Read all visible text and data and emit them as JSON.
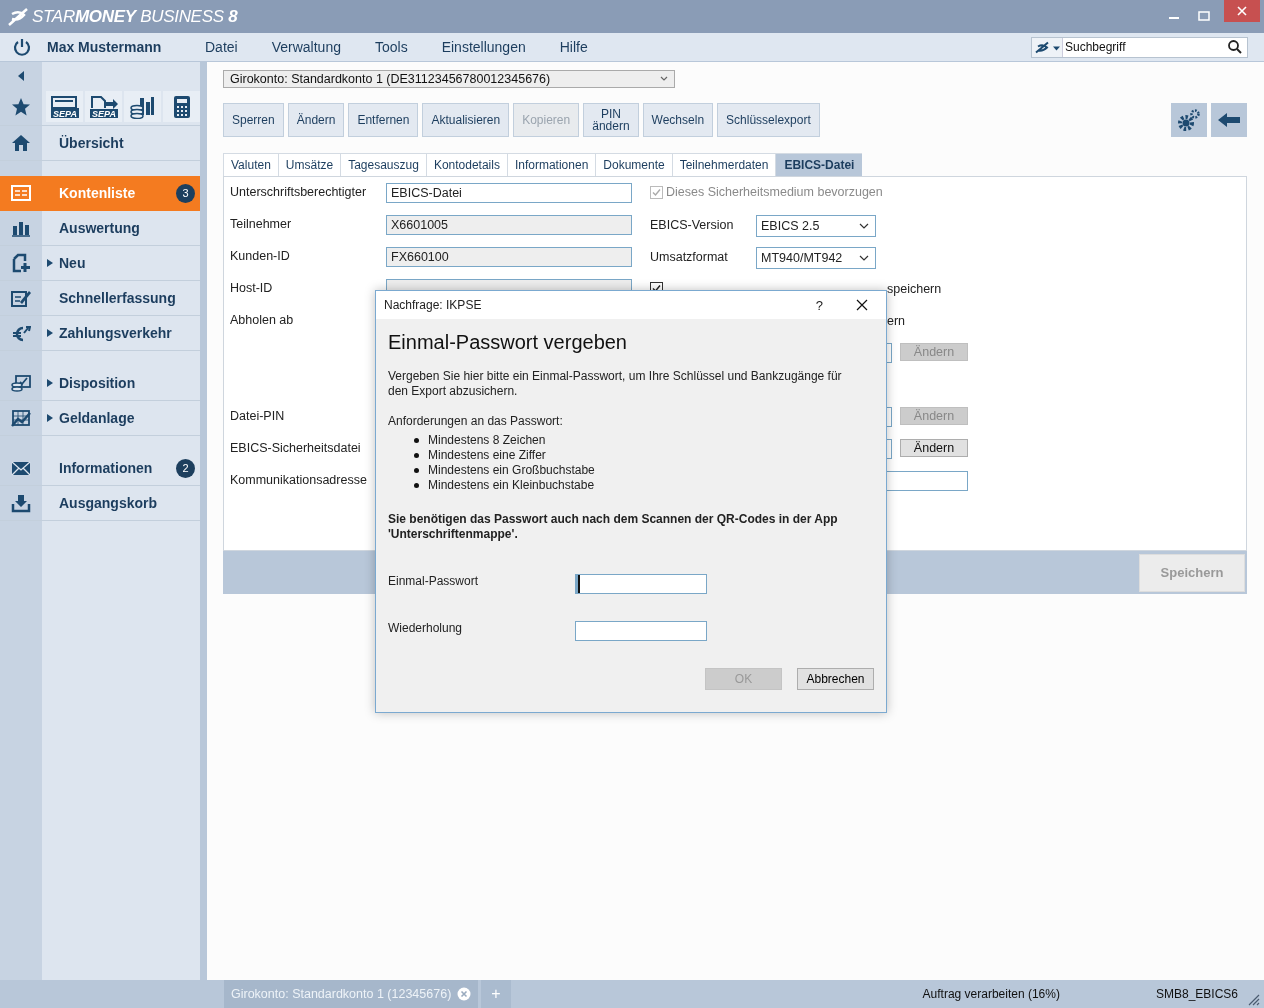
{
  "window": {
    "title": "STAR**MONEY** BUSINESS **8**"
  },
  "menubar": {
    "user": "Max Mustermann",
    "menus": [
      "Datei",
      "Verwaltung",
      "Tools",
      "Einstellungen",
      "Hilfe"
    ],
    "search": {
      "placeholder": "Suchbegriff"
    }
  },
  "sidebar": {
    "tools": [
      {
        "kind": "sepa",
        "label": "SEPA"
      },
      {
        "kind": "sepa_export",
        "label": "SEPA"
      },
      {
        "kind": "coins"
      },
      {
        "kind": "calculator"
      }
    ],
    "groups": [
      [
        {
          "label": "Übersicht",
          "kind": "home",
          "expander": false,
          "selected": false
        }
      ],
      [
        {
          "label": "Kontenliste",
          "kind": "list",
          "expander": false,
          "selected": true,
          "badge": "3"
        },
        {
          "label": "Auswertung",
          "kind": "chart",
          "expander": false,
          "selected": false
        },
        {
          "label": "Neu",
          "kind": "new",
          "expander": true,
          "selected": false
        },
        {
          "label": "Schnellerfassung",
          "kind": "edit",
          "expander": false,
          "selected": false
        },
        {
          "label": "Zahlungsverkehr",
          "kind": "euro",
          "expander": true,
          "selected": false
        }
      ],
      [
        {
          "label": "Disposition",
          "kind": "disposition",
          "expander": true,
          "selected": false
        },
        {
          "label": "Geldanlage",
          "kind": "invest",
          "expander": true,
          "selected": false
        }
      ],
      [
        {
          "label": "Informationen",
          "kind": "mail",
          "expander": false,
          "selected": false,
          "badge": "2"
        },
        {
          "label": "Ausgangskorb",
          "kind": "download",
          "expander": false,
          "selected": false
        }
      ]
    ]
  },
  "account_select": {
    "value": "Girokonto: Standardkonto 1 (DE31123456780012345676)"
  },
  "toolbar": [
    {
      "label": "Sperren",
      "disabled": false
    },
    {
      "label": "Ändern",
      "disabled": false
    },
    {
      "label": "Entfernen",
      "disabled": false
    },
    {
      "label": "Aktualisieren",
      "disabled": false
    },
    {
      "label": "Kopieren",
      "disabled": true
    },
    {
      "label": "PIN\nändern",
      "disabled": false
    },
    {
      "label": "Wechseln",
      "disabled": false
    },
    {
      "label": "Schlüsselexport",
      "disabled": false
    }
  ],
  "tabs": [
    {
      "label": "Valuten",
      "selected": false
    },
    {
      "label": "Umsätze",
      "selected": false
    },
    {
      "label": "Tagesauszug",
      "selected": false
    },
    {
      "label": "Kontodetails",
      "selected": false
    },
    {
      "label": "Informationen",
      "selected": false
    },
    {
      "label": "Dokumente",
      "selected": false
    },
    {
      "label": "Teilnehmerdaten",
      "selected": false
    },
    {
      "label": "EBICS-Datei",
      "selected": true
    }
  ],
  "form": {
    "rows": [
      {
        "label": "Unterschriftsberechtigter",
        "field": {
          "value": "EBICS-Datei",
          "readonly": false
        },
        "right": {
          "kind": "checkbox",
          "label": "Dieses Sicherheitsmedium bevorzugen",
          "checked": true,
          "disabled": true
        }
      },
      {
        "label": "Teilnehmer",
        "field": {
          "value": "X6601005",
          "readonly": true
        },
        "right": {
          "kind": "select",
          "label": "EBICS-Version",
          "value": "EBICS 2.5"
        }
      },
      {
        "label": "Kunden-ID",
        "field": {
          "value": "FX660100",
          "readonly": true
        },
        "right": {
          "kind": "select",
          "label": "Umsatzformat",
          "value": "MT940/MT942"
        }
      },
      {
        "label": "Host-ID",
        "field": {
          "readonly": true
        },
        "right": {
          "kind": "checkbox_cut",
          "label": "speichern",
          "checked": true
        }
      },
      {
        "label": "Abholen ab",
        "right": {
          "kind": "fragment",
          "label": "ern"
        }
      },
      {
        "right": {
          "kind": "field_button",
          "button": "Ändern",
          "disabled": true
        }
      },
      {},
      {
        "label": "Datei-PIN",
        "right": {
          "kind": "field_button",
          "button": "Ändern",
          "disabled": true
        }
      },
      {
        "label": "EBICS-Sicherheitsdatei",
        "right": {
          "kind": "field_button",
          "button": "Ändern",
          "disabled": false
        }
      },
      {
        "label": "Kommunikationsadresse",
        "right": {
          "kind": "wide_field"
        }
      }
    ],
    "save_button": {
      "label": "Speichern",
      "disabled": true
    }
  },
  "dialog": {
    "title": "Nachfrage: IKPSE",
    "help": "?",
    "heading": "Einmal-Passwort vergeben",
    "intro": "Vergeben Sie hier bitte ein Einmal-Passwort, um Ihre Schlüssel und Bankzugänge für den Export abzusichern.",
    "requirements_title": "Anforderungen an das Passwort:",
    "requirements": [
      "Mindestens 8 Zeichen",
      "Mindestens eine Ziffer",
      "Mindestens ein Großbuchstabe",
      "Mindestens ein Kleinbuchstabe"
    ],
    "note": "Sie benötigen das Passwort auch nach dem Scannen der QR-Codes in der App 'Unterschriftenmappe'.",
    "fields": [
      {
        "label": "Einmal-Passwort",
        "focused": true
      },
      {
        "label": "Wiederholung",
        "focused": false
      }
    ],
    "buttons": [
      {
        "label": "OK",
        "disabled": true
      },
      {
        "label": "Abbrechen",
        "disabled": false
      }
    ]
  },
  "status_bar": {
    "tabs": [
      {
        "label": "Girokonto: Standardkonto 1 (12345676)"
      }
    ],
    "add": "+",
    "status": "Auftrag verarbeiten (16%)",
    "id": "SMB8_EBICS6"
  }
}
